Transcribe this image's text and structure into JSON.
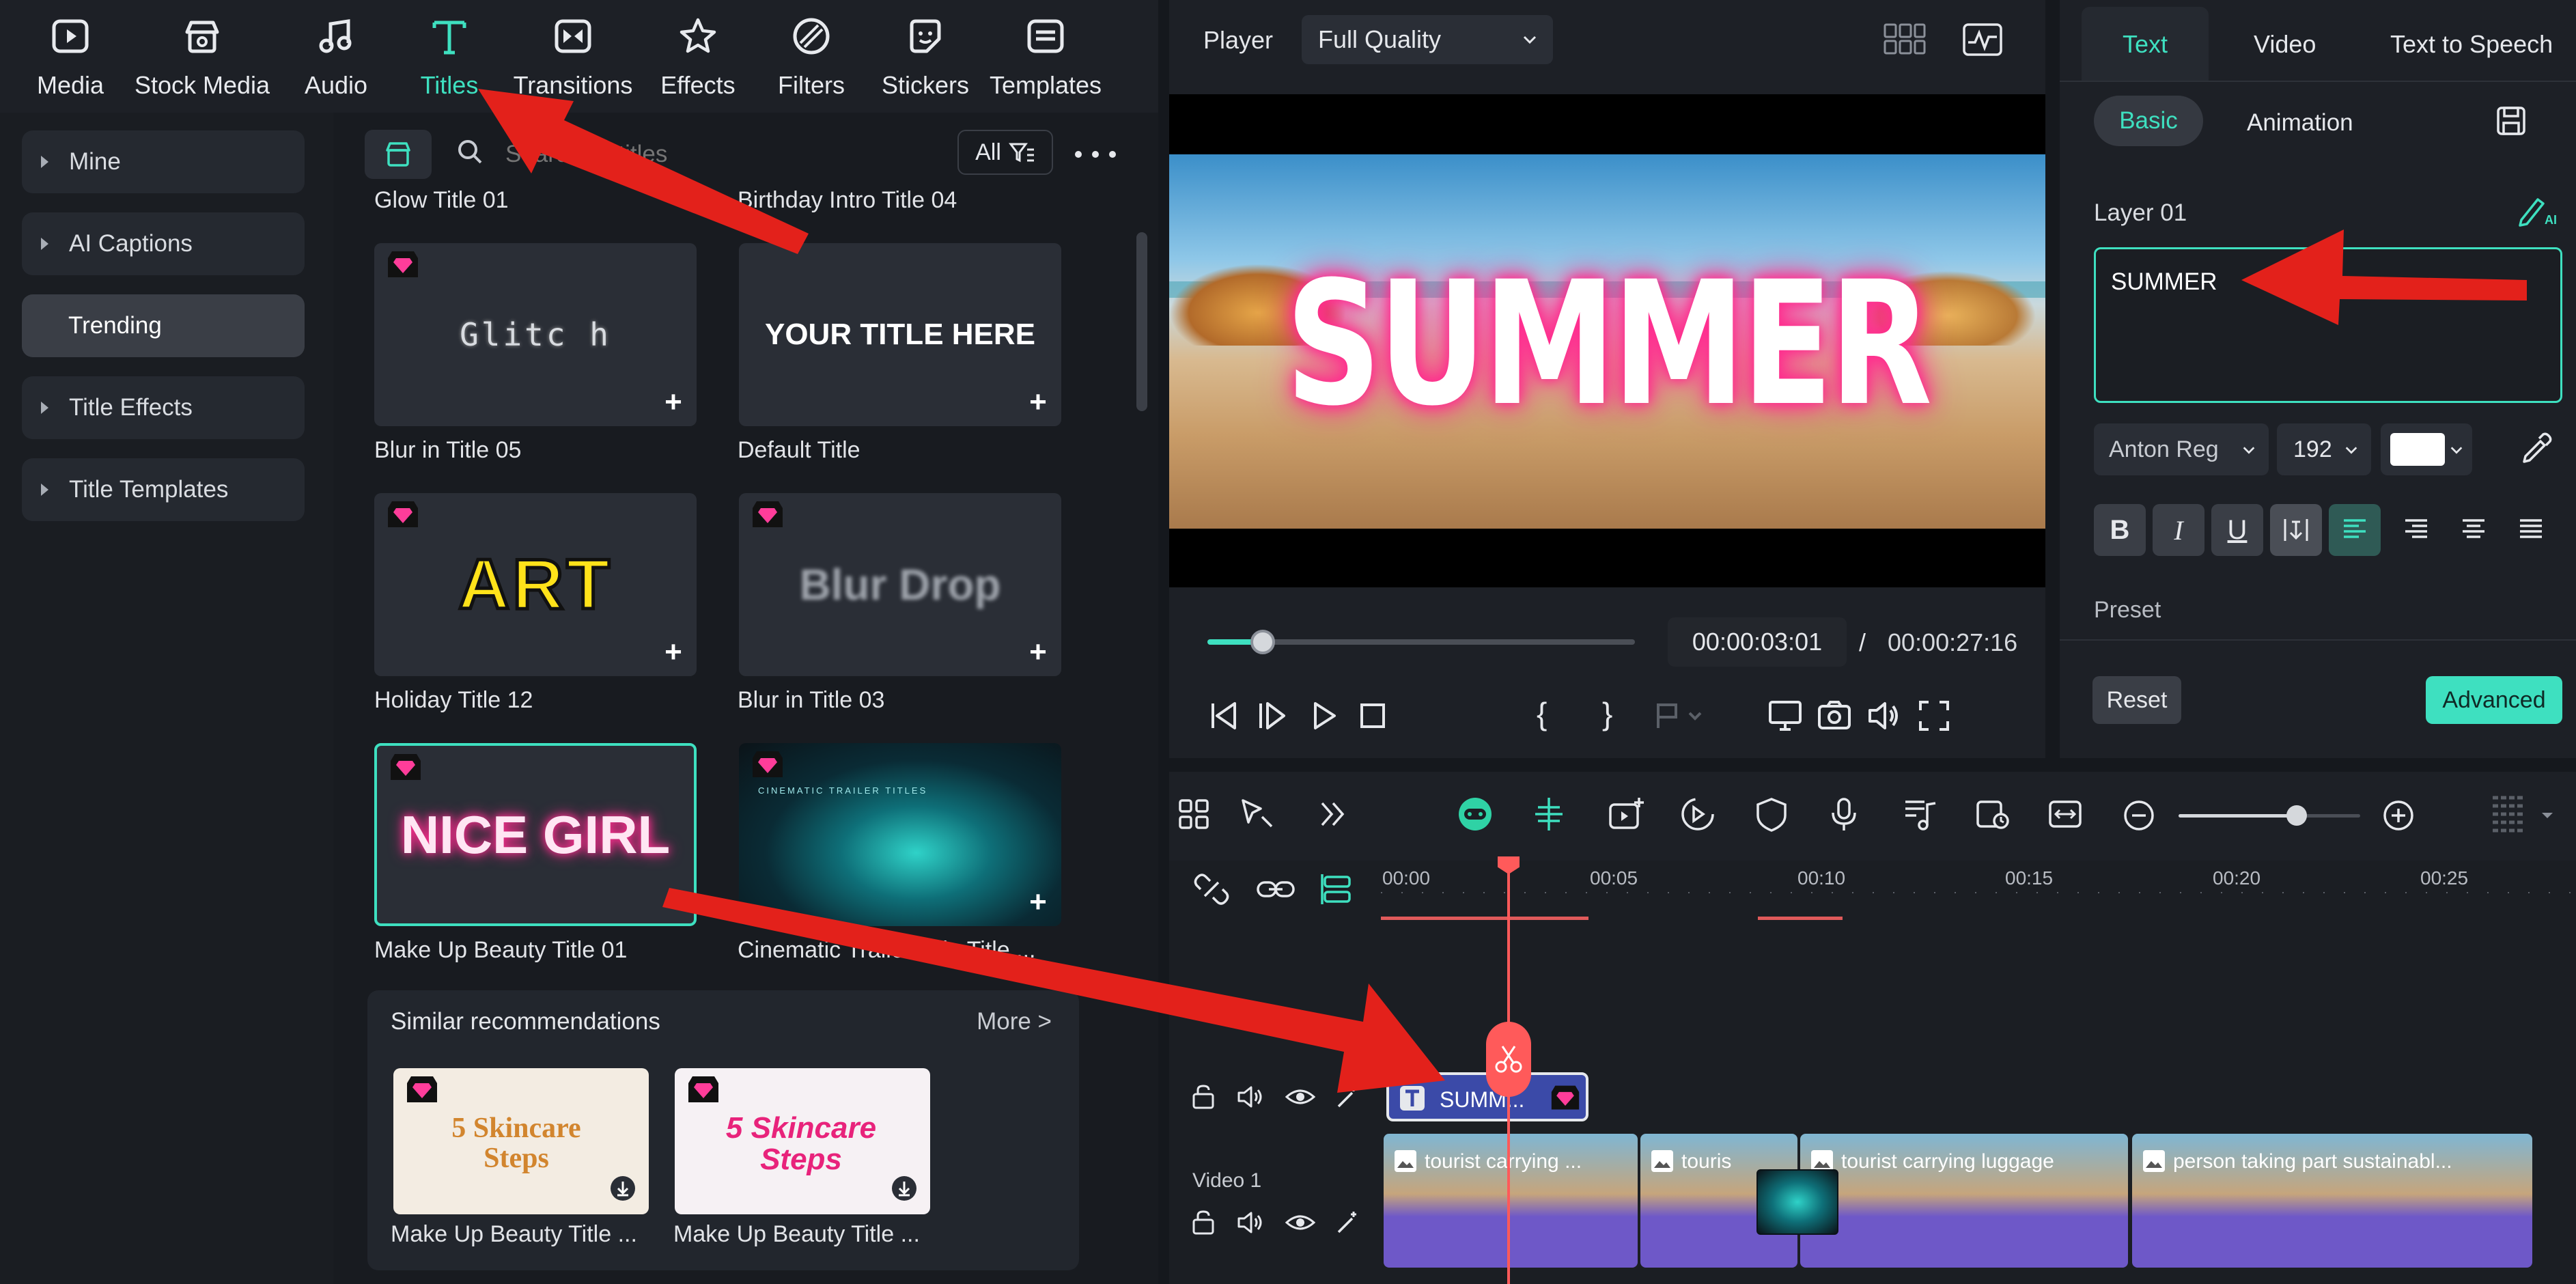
{
  "nav": {
    "items": [
      {
        "label": "Media",
        "icon": "media-icon"
      },
      {
        "label": "Stock Media",
        "icon": "stock-media-icon"
      },
      {
        "label": "Audio",
        "icon": "audio-icon"
      },
      {
        "label": "Titles",
        "icon": "titles-icon"
      },
      {
        "label": "Transitions",
        "icon": "transitions-icon"
      },
      {
        "label": "Effects",
        "icon": "effects-icon"
      },
      {
        "label": "Filters",
        "icon": "filters-icon"
      },
      {
        "label": "Stickers",
        "icon": "stickers-icon"
      },
      {
        "label": "Templates",
        "icon": "templates-icon"
      }
    ],
    "active": "Titles"
  },
  "sidebar": {
    "items": [
      {
        "label": "Mine"
      },
      {
        "label": "AI Captions"
      },
      {
        "label": "Trending"
      },
      {
        "label": "Title Effects"
      },
      {
        "label": "Title Templates"
      }
    ]
  },
  "search": {
    "placeholder": "Search all titles",
    "filter_label": "All"
  },
  "titles": {
    "partial_labels": [
      "Glow Title 01",
      "Birthday Intro Title 04"
    ],
    "cards": [
      {
        "label": "Blur in Title 05",
        "thumb_text": "Glitc h"
      },
      {
        "label": "Default Title",
        "thumb_text": "YOUR TITLE HERE"
      },
      {
        "label": "Holiday Title 12",
        "thumb_text": "ART"
      },
      {
        "label": "Blur in Title 03",
        "thumb_text": "Blur Drop"
      },
      {
        "label": "Make Up Beauty Title 01",
        "thumb_text": "NICE GIRL"
      },
      {
        "label": "Cinematic Trailer Title Title ...",
        "thumb_text": "CINEMATIC TRAILER TITLES"
      }
    ]
  },
  "similar": {
    "title": "Similar recommendations",
    "more": "More >",
    "items": [
      {
        "label": "Make Up Beauty Title ...",
        "thumb_text": "5 Skincare Steps"
      },
      {
        "label": "Make Up Beauty Title ...",
        "thumb_text": "5 Skincare Steps"
      }
    ]
  },
  "player": {
    "label": "Player",
    "quality": "Full Quality",
    "preview_text": "SUMMER",
    "current_time": "00:00:03:01",
    "separator": "/",
    "total_time": "00:00:27:16",
    "progress": 0.13
  },
  "props": {
    "tabs": [
      "Text",
      "Video",
      "Text to Speech"
    ],
    "subtabs": [
      "Basic",
      "Animation"
    ],
    "layer_label": "Layer 01",
    "text_value": "SUMMER",
    "font": "Anton Reg",
    "font_size": "192",
    "text_color": "#ffffff",
    "preset_label": "Preset",
    "reset_label": "Reset",
    "advanced_label": "Advanced"
  },
  "timeline": {
    "ruler": [
      "00:00",
      "00:05",
      "00:10",
      "00:15",
      "00:20",
      "00:25"
    ],
    "title_clip": "SUMM...",
    "track_label": "Video 1",
    "clips": [
      "tourist carrying ...",
      "touris",
      "tourist carrying luggage",
      "person taking part sustainabl..."
    ],
    "zoom": 0.65
  }
}
